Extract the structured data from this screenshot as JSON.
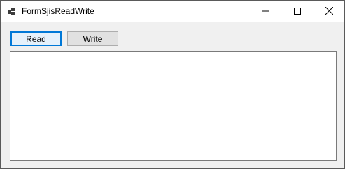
{
  "window": {
    "title": "FormSjisReadWrite",
    "icon": "app-form-icon",
    "controls": {
      "minimize_icon": "minimize-icon",
      "maximize_icon": "maximize-icon",
      "close_icon": "close-icon"
    }
  },
  "toolbar": {
    "read_label": "Read",
    "write_label": "Write"
  },
  "content": {
    "textbox_value": ""
  },
  "colors": {
    "accent": "#0078d7",
    "window_bg": "#f0f0f0",
    "titlebar_bg": "#ffffff"
  }
}
